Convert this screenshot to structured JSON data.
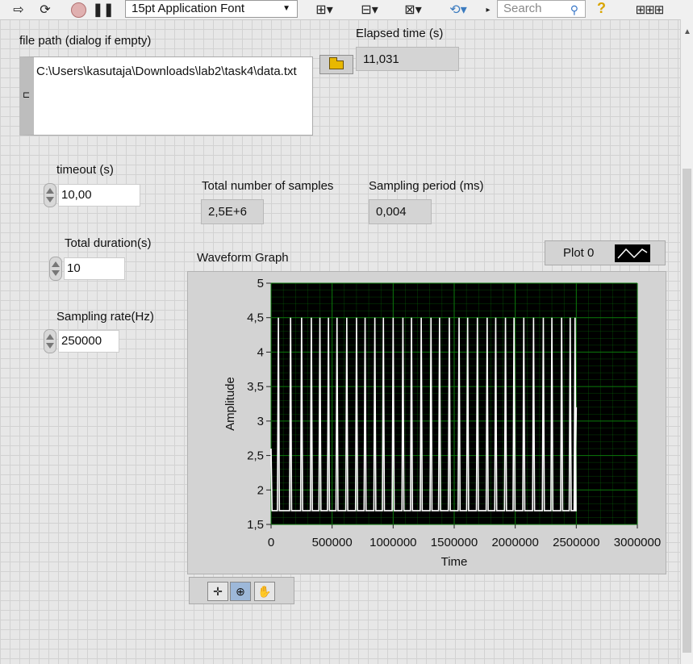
{
  "toolbar": {
    "font_label": "15pt Application Font",
    "search_placeholder": "Search",
    "icons": [
      "run-arrow-icon",
      "run-continuous-icon",
      "abort-icon",
      "pause-icon",
      "align-icon",
      "distribute-icon",
      "resize-icon",
      "reorder-icon",
      "help-icon"
    ]
  },
  "file_path": {
    "label": "file path (dialog if empty)",
    "value": "C:\\Users\\kasutaja\\Downloads\\lab2\\task4\\data.txt"
  },
  "elapsed_time": {
    "label": "Elapsed time (s)",
    "value": "11,031"
  },
  "timeout": {
    "label": "timeout (s)",
    "value": "10,00"
  },
  "total_samples": {
    "label": "Total number of samples",
    "value": "2,5E+6"
  },
  "sampling_period": {
    "label": "Sampling period (ms)",
    "value": "0,004"
  },
  "total_duration": {
    "label": "Total duration(s)",
    "value": "10"
  },
  "sampling_rate": {
    "label": "Sampling rate(Hz)",
    "value": "250000"
  },
  "graph": {
    "title": "Waveform Graph",
    "legend_label": "Plot 0"
  },
  "chart_data": {
    "type": "line",
    "title": "Waveform Graph",
    "xlabel": "Time",
    "ylabel": "Amplitude",
    "xlim": [
      0,
      3000000
    ],
    "ylim": [
      1.5,
      5
    ],
    "x_ticks": [
      "0",
      "500000",
      "1000000",
      "1500000",
      "2000000",
      "2500000",
      "3000000"
    ],
    "y_ticks": [
      "1,5",
      "2",
      "2,5",
      "3",
      "3,5",
      "4",
      "4,5",
      "5"
    ],
    "grid": true,
    "series": [
      {
        "name": "Plot 0",
        "low": 1.7,
        "high": 4.5,
        "pulse_x": [
          0,
          60000,
          160000,
          250000,
          330000,
          400000,
          470000,
          540000,
          620000,
          700000,
          770000,
          850000,
          920000,
          1000000,
          1080000,
          1150000,
          1230000,
          1310000,
          1380000,
          1460000,
          1540000,
          1610000,
          1690000,
          1770000,
          1840000,
          1920000,
          1990000,
          2070000,
          2150000,
          2230000,
          2300000,
          2380000,
          2450000,
          2490000
        ],
        "x_end": 2500000
      }
    ],
    "colors": {
      "background": "#000000",
      "grid": "#0b7a0b",
      "plot": "#ffffff"
    }
  }
}
